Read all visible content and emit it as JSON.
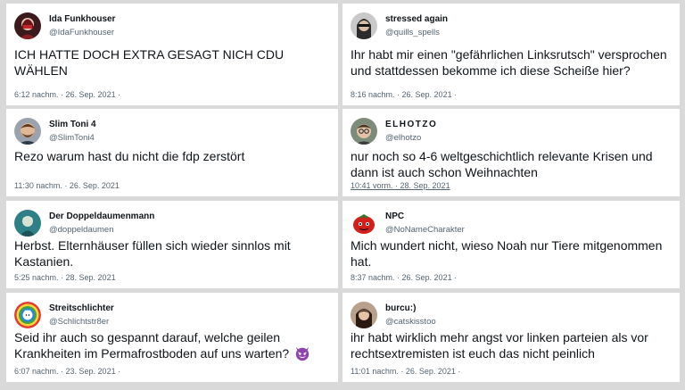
{
  "tweets": [
    {
      "name": "Ida Funkhouser",
      "handle": "@IdaFunkhouser",
      "text": "ICH HATTE DOCH EXTRA GESAGT NICH CDU WÄHLEN",
      "meta": "6:12 nachm. · 26. Sep. 2021 ·",
      "avatar": "woman-red-mask-avatar"
    },
    {
      "name": "stressed again",
      "handle": "@quills_spells",
      "text": "Ihr habt mir einen \"gefährlichen Linksrutsch\" versprochen und stattdessen bekomme ich diese Scheiße hier?",
      "meta": "8:16 nachm. · 26. Sep. 2021 ·",
      "avatar": "woman-sunglasses-avatar"
    },
    {
      "name": "Slim Toni 4",
      "handle": "@SlimToni4",
      "text": "Rezo warum hast du nicht die fdp zerstört",
      "meta": "11:30 nachm. · 26. Sep. 2021",
      "avatar": "man-beard-avatar"
    },
    {
      "name": "ELHOTZO",
      "handle": "@elhotzo",
      "text": "nur noch so 4-6 weltgeschichtlich relevante Krisen und dann ist auch schon Weihnachten",
      "meta": "10:41 vorm. · 28. Sep. 2021",
      "avatar": "man-glasses-avatar"
    },
    {
      "name": "Der Doppeldaumenmann",
      "handle": "@doppeldaumen",
      "text": "Herbst. Elternhäuser füllen sich wieder sinnlos mit Kastanien.",
      "meta": "5:25 nachm. · 28. Sep. 2021",
      "avatar": "teal-portrait-avatar"
    },
    {
      "name": "NPC",
      "handle": "@NoNameCharakter",
      "text": "Mich wundert nicht, wieso Noah nur Tiere mitgenommen hat.",
      "meta": "8:37 nachm. · 26. Sep. 2021 ·",
      "avatar": "tomato-character-avatar"
    },
    {
      "name": "Streitschlichter",
      "handle": "@Schlichtstr8er",
      "text": "Seid ihr auch so gespannt darauf, welche geilen Krankheiten im Permafrostboden auf uns warten?",
      "meta": "6:07 nachm. · 23. Sep. 2021 ·",
      "avatar": "rainbow-cat-avatar",
      "emoji": "smiling-devil-emoji"
    },
    {
      "name": "burcu:)",
      "handle": "@catskisstoo",
      "text": "ihr habt wirklich mehr angst vor linken parteien als vor rechtsextremisten ist euch das nicht peinlich",
      "meta": "11:01 nachm. · 26. Sep. 2021 ·",
      "avatar": "woman-dark-hair-avatar"
    }
  ]
}
